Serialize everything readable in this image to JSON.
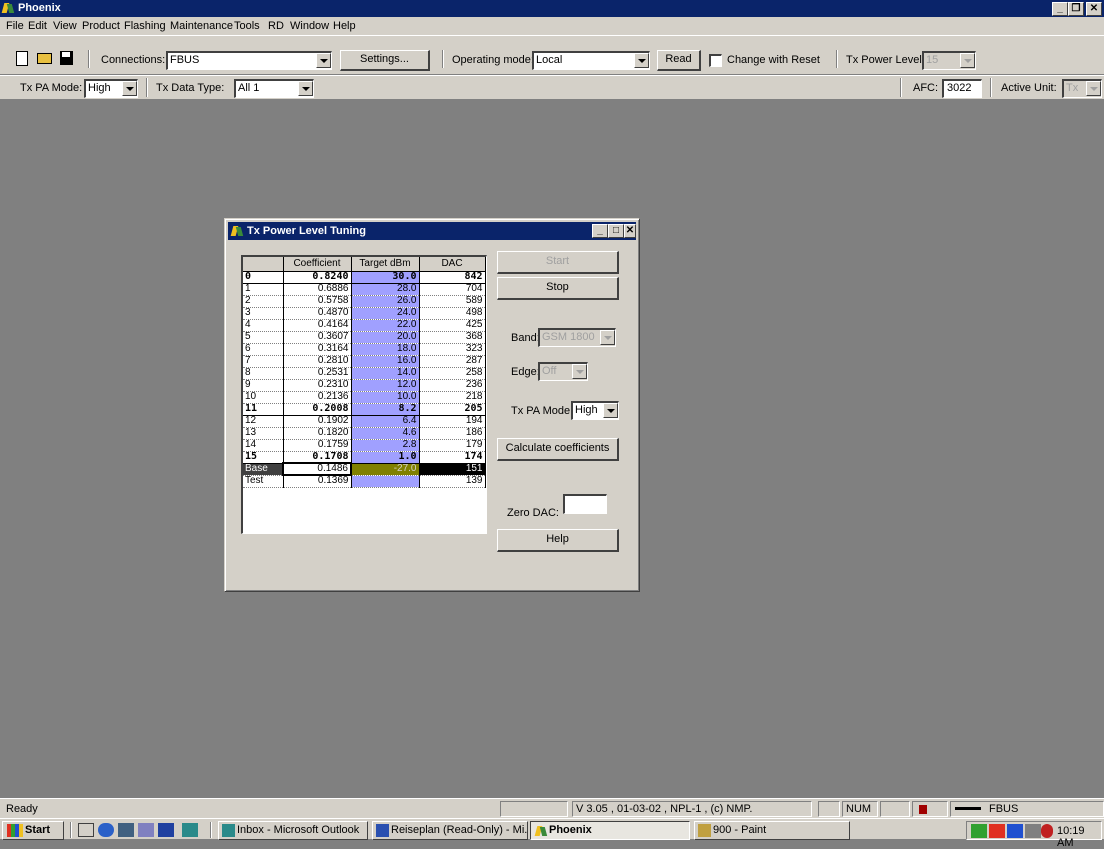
{
  "app": {
    "title": "Phoenix",
    "caption_buttons": [
      "minimize",
      "restore",
      "close"
    ]
  },
  "menu": [
    "File",
    "Edit",
    "View",
    "Product",
    "Flashing",
    "Maintenance",
    "Tools",
    "RD",
    "Window",
    "Help"
  ],
  "toolbar1": {
    "connections_label": "Connections:",
    "connections_value": "FBUS",
    "settings_button": "Settings...",
    "operating_mode_label": "Operating mode:",
    "operating_mode_value": "Local",
    "read_button": "Read",
    "change_with_reset_label": "Change with Reset",
    "change_with_reset_checked": false,
    "tx_power_level_label": "Tx Power Level:",
    "tx_power_level_value": "15"
  },
  "toolbar2": {
    "tx_pa_mode_label": "Tx PA Mode:",
    "tx_pa_mode_value": "High",
    "tx_data_type_label": "Tx Data Type:",
    "tx_data_type_value": "All 1",
    "afc_label": "AFC:",
    "afc_value": "3022",
    "active_unit_label": "Active Unit:",
    "active_unit_value": "Tx"
  },
  "dialog": {
    "title": "Tx Power Level Tuning",
    "columns": [
      "",
      "Coefficient",
      "Target dBm",
      "DAC"
    ],
    "rows": [
      {
        "label": "0",
        "coefficient": "0.8240",
        "target": "30.0",
        "dac": "842",
        "bold": true
      },
      {
        "label": "1",
        "coefficient": "0.6886",
        "target": "28.0",
        "dac": "704",
        "bold": false
      },
      {
        "label": "2",
        "coefficient": "0.5758",
        "target": "26.0",
        "dac": "589",
        "bold": false
      },
      {
        "label": "3",
        "coefficient": "0.4870",
        "target": "24.0",
        "dac": "498",
        "bold": false
      },
      {
        "label": "4",
        "coefficient": "0.4164",
        "target": "22.0",
        "dac": "425",
        "bold": false
      },
      {
        "label": "5",
        "coefficient": "0.3607",
        "target": "20.0",
        "dac": "368",
        "bold": false
      },
      {
        "label": "6",
        "coefficient": "0.3164",
        "target": "18.0",
        "dac": "323",
        "bold": false
      },
      {
        "label": "7",
        "coefficient": "0.2810",
        "target": "16.0",
        "dac": "287",
        "bold": false
      },
      {
        "label": "8",
        "coefficient": "0.2531",
        "target": "14.0",
        "dac": "258",
        "bold": false
      },
      {
        "label": "9",
        "coefficient": "0.2310",
        "target": "12.0",
        "dac": "236",
        "bold": false
      },
      {
        "label": "10",
        "coefficient": "0.2136",
        "target": "10.0",
        "dac": "218",
        "bold": false
      },
      {
        "label": "11",
        "coefficient": "0.2008",
        "target": "8.2",
        "dac": "205",
        "bold": true
      },
      {
        "label": "12",
        "coefficient": "0.1902",
        "target": "6.4",
        "dac": "194",
        "bold": false
      },
      {
        "label": "13",
        "coefficient": "0.1820",
        "target": "4.6",
        "dac": "186",
        "bold": false
      },
      {
        "label": "14",
        "coefficient": "0.1759",
        "target": "2.8",
        "dac": "179",
        "bold": false
      },
      {
        "label": "15",
        "coefficient": "0.1708",
        "target": "1.0",
        "dac": "174",
        "bold": true
      },
      {
        "label": "Base",
        "coefficient": "0.1486",
        "target": "-27.0",
        "dac": "151",
        "bold": false,
        "base": true
      },
      {
        "label": "Test",
        "coefficient": "0.1369",
        "target": "",
        "dac": "139",
        "bold": false
      }
    ],
    "start_button": "Start",
    "stop_button": "Stop",
    "band_label": "Band:",
    "band_value": "GSM 1800",
    "edge_label": "Edge:",
    "edge_value": "Off",
    "tx_pa_mode_label": "Tx PA Mode:",
    "tx_pa_mode_value": "High",
    "calculate_button": "Calculate coefficients",
    "zero_dac_label": "Zero DAC:",
    "zero_dac_value": "",
    "help_button": "Help"
  },
  "statusbar": {
    "status": "Ready",
    "version": "V 3.05 , 01-03-02 , NPL-1 , (c) NMP.",
    "num": "NUM",
    "connection": "FBUS"
  },
  "taskbar": {
    "start": "Start",
    "tasks": [
      {
        "label": "Inbox - Microsoft Outlook",
        "active": false
      },
      {
        "label": "Reiseplan (Read-Only) - Mi...",
        "active": false
      },
      {
        "label": "Phoenix",
        "active": true
      },
      {
        "label": "900 - Paint",
        "active": false
      }
    ],
    "clock": "10:19 AM"
  },
  "colors": {
    "titlebar": "#0a246a",
    "desktop": "#808080",
    "target_column": "#a0a0ff",
    "base_target": "#808000"
  }
}
